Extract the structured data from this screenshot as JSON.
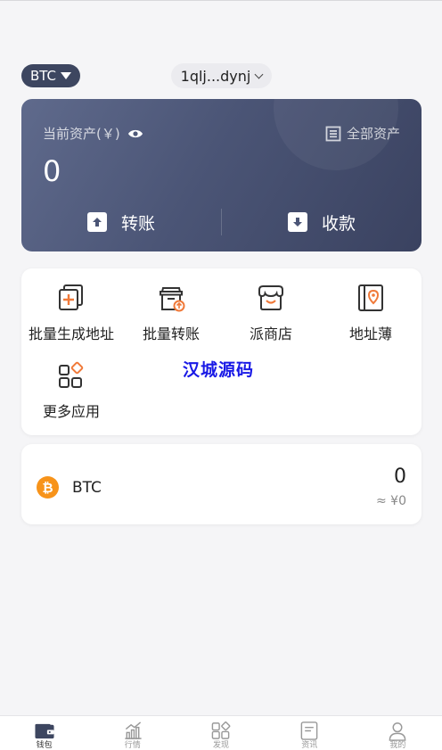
{
  "header": {
    "coin_selector": "BTC",
    "address": "1qlj...dynj"
  },
  "asset_card": {
    "label": "当前资产(￥)",
    "all_assets": "全部资产",
    "value": "0",
    "transfer_label": "转账",
    "receive_label": "收款"
  },
  "quick_actions": [
    {
      "label": "批量生成地址",
      "icon": "batch-generate-address-icon"
    },
    {
      "label": "批量转账",
      "icon": "batch-transfer-icon"
    },
    {
      "label": "派商店",
      "icon": "store-icon"
    },
    {
      "label": "地址薄",
      "icon": "address-book-icon"
    },
    {
      "label": "更多应用",
      "icon": "more-apps-icon"
    }
  ],
  "watermark": "汉城源码",
  "coins": [
    {
      "name": "BTC",
      "amount": "0",
      "fiat": "≈ ¥0",
      "icon": "bitcoin-icon"
    }
  ],
  "tabbar": [
    {
      "label": "钱包",
      "icon": "wallet-icon",
      "active": true
    },
    {
      "label": "行情",
      "icon": "market-chart-icon",
      "active": false
    },
    {
      "label": "发现",
      "icon": "discover-icon",
      "active": false
    },
    {
      "label": "资讯",
      "icon": "news-icon",
      "active": false
    },
    {
      "label": "我的",
      "icon": "profile-icon",
      "active": false
    }
  ],
  "colors": {
    "accent": "#3d4660",
    "orange": "#f07a3a",
    "bitcoin": "#f7931a",
    "watermark": "#1a1ae6"
  }
}
